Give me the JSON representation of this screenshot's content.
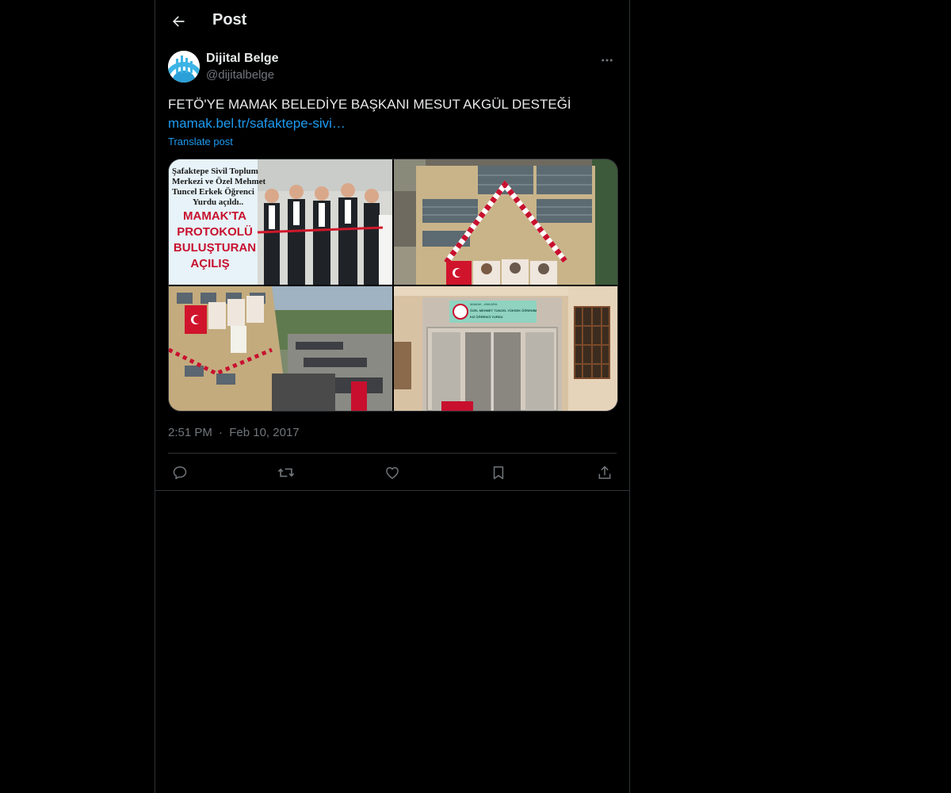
{
  "header": {
    "title": "Post",
    "back_icon": "arrow-left-icon"
  },
  "post": {
    "author_name": "Dijital Belge",
    "author_handle": "@dijitalbelge",
    "text": "FETÖ'YE MAMAK BELEDİYE BAŞKANI MESUT AKGÜL DESTEĞİ",
    "link_text": "mamak.bel.tr/safaktepe-sivi…",
    "translate_label": "Translate post",
    "time": "2:51 PM",
    "separator": "·",
    "date": "Feb 10, 2017",
    "media": {
      "image1": {
        "caption_lines": [
          "Şafaktepe Sivil Toplum",
          "Merkezi ve Özel Mehmet",
          "Tuncel Erkek Öğrenci",
          "Yurdu açıldı.."
        ],
        "headline_lines": [
          "MAMAK'TA",
          "PROTOKOLÜ",
          "BULUŞTURAN",
          "AÇILIŞ"
        ]
      },
      "image4": {
        "sign_lines": [
          "MAMAK - ANKARA",
          "ÖZEL MEHMET TUNCEL YÜKSEK ÖĞRENİM",
          "KIZ ÖĞRENCİ YURDU"
        ]
      }
    }
  },
  "actions": {
    "reply_icon": "reply-icon",
    "repost_icon": "repost-icon",
    "like_icon": "heart-icon",
    "bookmark_icon": "bookmark-icon",
    "share_icon": "share-icon"
  },
  "colors": {
    "background": "#000000",
    "text": "#e7e9ea",
    "muted": "#71767b",
    "link": "#1d9bf0",
    "border": "#2f3336"
  }
}
